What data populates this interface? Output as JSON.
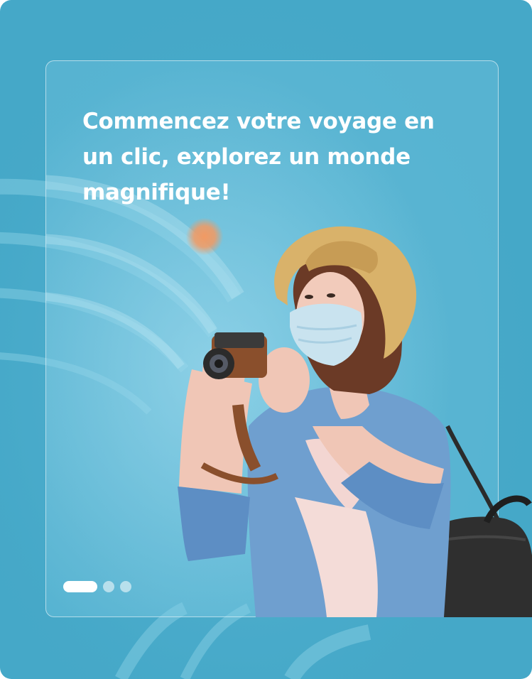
{
  "onboarding": {
    "headline": "Commencez votre voyage en un clic, explorez un monde magnifique!",
    "pagination": {
      "total": 3,
      "active_index": 0
    }
  },
  "illustration": {
    "subject": "traveler-woman-with-camera-icon",
    "accent_dot": "sun-dot-icon"
  },
  "colors": {
    "background": "#45a8c8",
    "card_tint": "#78c8e1",
    "accent_orange": "#f29a63",
    "text": "#ffffff"
  }
}
